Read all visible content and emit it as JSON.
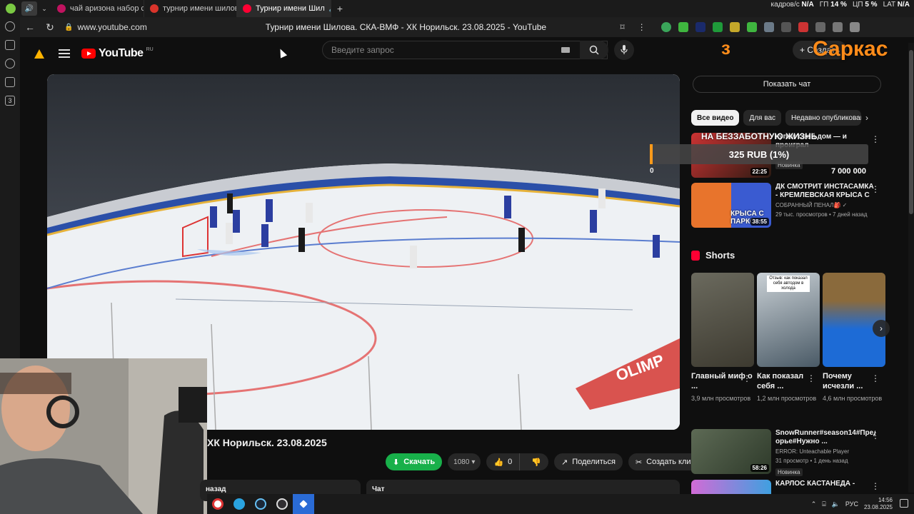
{
  "browser": {
    "tabs": [
      {
        "title": "чай аризона набор саапр",
        "active": false,
        "color": "#c0135f"
      },
      {
        "title": "турнир имени шилова —",
        "active": false,
        "color": "#d9342b"
      },
      {
        "title": "Турнир имени Шил",
        "active": true,
        "color": "#ff0033"
      }
    ],
    "stats": {
      "net_label": "кадров/с",
      "net_value": "N/A",
      "gpu_label": "ГП",
      "gpu_value": "14 %",
      "cpu_label": "ЦП",
      "cpu_value": "5 %",
      "lat_label": "LAT",
      "lat_value": "N/A"
    },
    "url": "www.youtube.com",
    "page_title": "Турнир имени Шилова. СКА-ВМФ - ХК Норильск. 23.08.2025 - YouTube",
    "sidebar_badge": "3"
  },
  "youtube": {
    "region": "RU",
    "search_placeholder": "Введите запрос",
    "create_label": "+ Создать",
    "overlay_brand": "Саркас"
  },
  "video": {
    "title": "ХК Норильск. 23.08.2025",
    "download_label": "Скачать",
    "quality": "1080",
    "likes": "0",
    "share_label": "Поделиться",
    "clip_label": "Создать клип",
    "desc_label": "назад",
    "chat_label": "Чат"
  },
  "right": {
    "show_chat": "Показать чат",
    "chips": [
      "Все видео",
      "Для вас",
      "Недавно опубликованн"
    ],
    "overlay_title": "НА БЕЗЗАБОТНУЮ ЖИЗНЬ",
    "donation": "325 RUB (1%)",
    "donation_start": "0",
    "donation_goal": "7 000 000",
    "recs": [
      {
        "title": "купил свой дом — и проиграл",
        "channel": "",
        "meta": "",
        "badge": "Новинка",
        "duration": "22:25",
        "colors": [
          "#c33",
          "#2a1a12"
        ]
      },
      {
        "title": "ДК СМОТРИТ ИНСТАСАМКА - КРЕМЛЕВСКАЯ КРЫСА С ...",
        "channel": "СОБРАННЫЙ ПЕНАЛ🎒 ✓",
        "meta": "29 тыс. просмотров • 7 дней назад",
        "badge": "",
        "duration": "38:55",
        "colors": [
          "#e8742c",
          "#3a5bd1"
        ]
      }
    ],
    "shorts_title": "Shorts",
    "shorts": [
      {
        "title": "Главный миф о ...",
        "views": "3,9 млн просмотров",
        "colors": [
          "#6b6a5e",
          "#3d3a30"
        ]
      },
      {
        "title": "Как показал себя ...",
        "views": "1,2 млн просмотров",
        "colors": [
          "#c9d0d5",
          "#4a5a66"
        ]
      },
      {
        "title": "Почему исчезли ...",
        "views": "4,6 млн просмотров",
        "colors": [
          "#1d6bd6",
          "#8a6a3c"
        ]
      }
    ],
    "shorts_caption": "Отзыв: как показал себя автодом в холода",
    "recs2": [
      {
        "title": "SnowRunner#season14#Предг орье#Нужно ...",
        "channel": "ERROR: Unteachable Player",
        "meta": "31 просмотр • 1 день назад",
        "badge": "Новинка",
        "duration": "58:26",
        "colors": [
          "#5d6a55",
          "#2e3a2a"
        ]
      },
      {
        "title": "КАРЛОС КАСТАНЕДА - ",
        "channel": "",
        "meta": "",
        "badge": "",
        "duration": "",
        "colors": [
          "#d26bd6",
          "#3fa0e0"
        ]
      }
    ]
  },
  "taskbar": {
    "apps": [
      "yandex-browser",
      "telegram",
      "steam",
      "obs",
      "app-blue"
    ],
    "lang": "РУС",
    "time": "14:56",
    "date": "23.08.2025"
  }
}
